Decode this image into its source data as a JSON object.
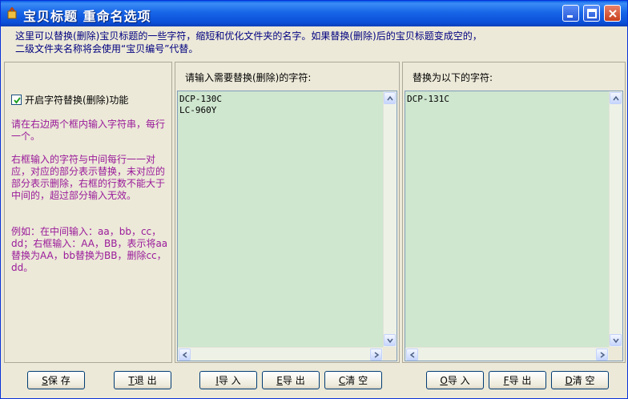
{
  "window": {
    "title": "宝贝标题 重命名选项"
  },
  "info": {
    "line1": "这里可以替换(删除)宝贝标题的一些字符，缩短和优化文件夹的名字。如果替换(删除)后的宝贝标题变成空的，",
    "line2": "二级文件夹名称将会使用“宝贝编号”代替。"
  },
  "left": {
    "checkbox_label": "开启字符替换(删除)功能",
    "checked": true,
    "hint1": "请在右边两个框内输入字符串，每行一个。",
    "hint2": "右框输入的字符与中间每行一一对应，对应的部分表示替换，未对应的部分表示删除，右框的行数不能大于中间的，超过部分输入无效。",
    "hint3": "例如：在中间输入：aa，bb，cc，dd；右框输入：AA，BB，表示将aa替换为AA，bb替换为BB，删除cc，dd。"
  },
  "middle": {
    "label": "请输入需要替换(删除)的字符:",
    "text": "DCP-130C\nLC-960Y"
  },
  "right": {
    "label": "替换为以下的字符:",
    "text": "DCP-131C"
  },
  "buttons": {
    "save": {
      "key": "S",
      "label": "保 存"
    },
    "exit": {
      "key": "T",
      "label": "退 出"
    },
    "import_left": {
      "key": "I",
      "label": "导 入"
    },
    "export_left": {
      "key": "E",
      "label": "导 出"
    },
    "clear_left": {
      "key": "C",
      "label": "清 空"
    },
    "import_right": {
      "key": "O",
      "label": "导 入"
    },
    "export_right": {
      "key": "F",
      "label": "导 出"
    },
    "clear_right": {
      "key": "D",
      "label": "清 空"
    }
  },
  "colors": {
    "titlebar": "#0a5ee8",
    "hint_text": "#9a1a9a",
    "info_text": "#000080",
    "textbox_bg": "#cfe6cf"
  }
}
